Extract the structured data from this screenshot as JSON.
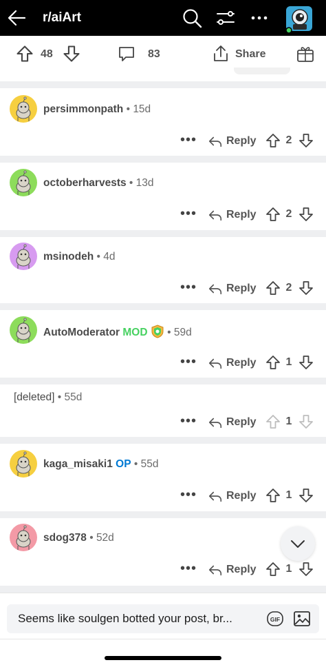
{
  "header": {
    "title": "r/aiArt"
  },
  "post_actions": {
    "upvotes": "48",
    "comments": "83",
    "share_label": "Share"
  },
  "comments": [
    {
      "author": "persimmonpath",
      "age": "15d",
      "score": "2",
      "reply_label": "Reply",
      "avatar_color": "#f6cf40"
    },
    {
      "author": "octoberharvests",
      "age": "13d",
      "score": "2",
      "reply_label": "Reply",
      "avatar_color": "#8ddc5b"
    },
    {
      "author": "msinodeh",
      "age": "4d",
      "score": "2",
      "reply_label": "Reply",
      "avatar_color": "#d79bf0"
    },
    {
      "author": "AutoModerator",
      "badge": "MOD",
      "age": "59d",
      "score": "1",
      "reply_label": "Reply",
      "avatar_color": "#8ddc5b"
    },
    {
      "author": "[deleted]",
      "age": "55d",
      "score": "1",
      "reply_label": "Reply"
    },
    {
      "author": "kaga_misaki1",
      "badge": "OP",
      "age": "55d",
      "score": "1",
      "reply_label": "Reply",
      "avatar_color": "#f6cf40"
    },
    {
      "author": "sdog378",
      "age": "52d",
      "score": "1",
      "reply_label": "Reply",
      "avatar_color": "#f39aa6"
    }
  ],
  "composer": {
    "placeholder": "Seems like soulgen botted your post, br..."
  },
  "colors": {
    "mod": "#46d160",
    "op": "#0079d3",
    "divider": "#eeeff1"
  },
  "icons": [
    "back-arrow-icon",
    "search-icon",
    "filter-icon",
    "more-icon",
    "profile-avatar-icon",
    "upvote-icon",
    "downvote-icon",
    "comment-icon",
    "share-icon",
    "award-icon",
    "reply-icon",
    "chevron-down-icon",
    "gif-icon",
    "image-icon",
    "shield-badge-icon"
  ]
}
